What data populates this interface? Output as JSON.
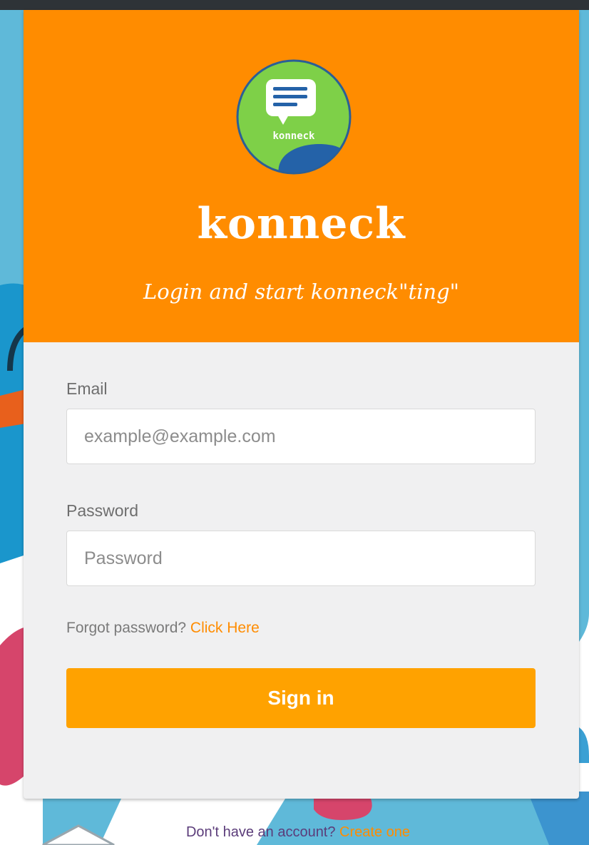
{
  "brand": {
    "name": "konneck",
    "logo_text": "konneck",
    "tagline": "Login and start konneck\"ting\""
  },
  "form": {
    "email_label": "Email",
    "email_placeholder": "example@example.com",
    "email_value": "",
    "password_label": "Password",
    "password_placeholder": "Password",
    "password_value": "",
    "forgot_text": "Forgot password?",
    "forgot_link": "Click Here",
    "submit_label": "Sign in"
  },
  "footer": {
    "signup_text": "Don't have an account?",
    "signup_link": "Create one"
  },
  "icons": {
    "logo_icon": "chat-bubble-icon"
  },
  "colors": {
    "header_orange": "#ff8c00",
    "button_orange": "#ffa200",
    "link_orange": "#ff8c00",
    "logo_green": "#7ed048",
    "logo_blue": "#2462a8",
    "page_background": "#5fb9d9",
    "card_background": "#f0f0f1"
  }
}
